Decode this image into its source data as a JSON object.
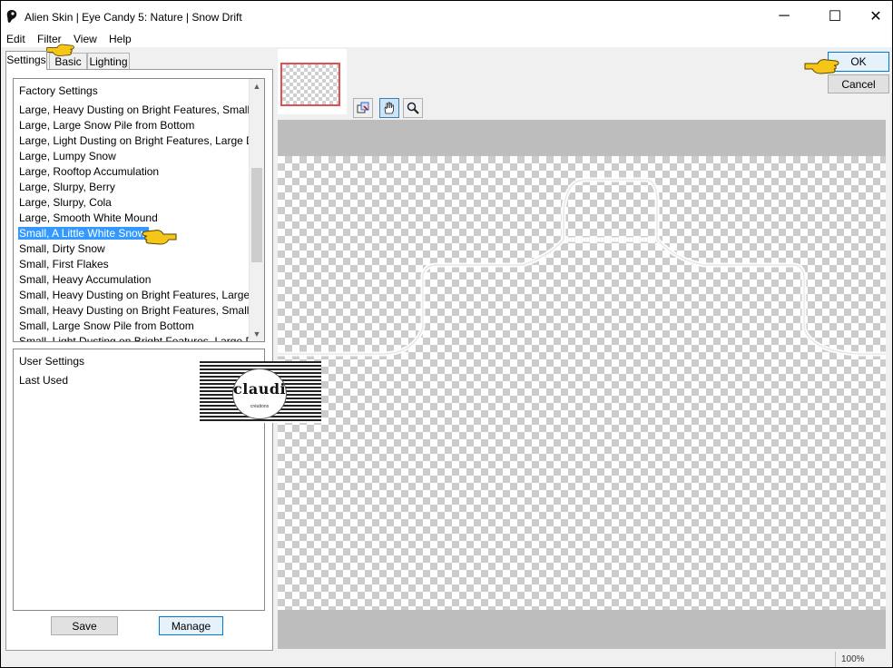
{
  "window": {
    "title": "Alien Skin | Eye Candy 5: Nature | Snow Drift",
    "minimize_glyph": "─",
    "maximize_glyph": "☐",
    "close_glyph": "✕"
  },
  "menu": [
    "Edit",
    "Filter",
    "View",
    "Help"
  ],
  "tabs": [
    "Settings",
    "Basic",
    "Lighting"
  ],
  "factory_settings": {
    "header": "Factory Settings",
    "items": [
      "Large, Heavy Dusting on Bright Features, Small Drift",
      "Large, Large Snow Pile from Bottom",
      "Large, Light Dusting on Bright Features, Large Drift",
      "Large, Lumpy Snow",
      "Large, Rooftop Accumulation",
      "Large, Slurpy, Berry",
      "Large, Slurpy, Cola",
      "Large, Smooth White Mound",
      "Small, A Little White Snow",
      "Small, Dirty Snow",
      "Small, First Flakes",
      "Small, Heavy Accumulation",
      "Small, Heavy Dusting on Bright Features, Large Drift",
      "Small, Heavy Dusting on Bright Features, Small Drift",
      "Small, Large Snow Pile from Bottom",
      "Small, Light Dusting on Bright Features, Large Drift"
    ],
    "selected_item": "Small, A Little White Snow"
  },
  "user_settings": {
    "header": "User Settings",
    "items": [
      "Last Used"
    ]
  },
  "buttons": {
    "save": "Save",
    "manage": "Manage",
    "ok": "OK",
    "cancel": "Cancel"
  },
  "tools": [
    "navigator-icon",
    "hand-icon",
    "zoom-icon"
  ],
  "watermark": {
    "text": "claudia",
    "subtext": "créations"
  },
  "status": {
    "zoom": "100%"
  },
  "colors": {
    "selection": "#3399ff",
    "pointer_hand": "#f5c518",
    "nav_frame": "#e05050"
  }
}
